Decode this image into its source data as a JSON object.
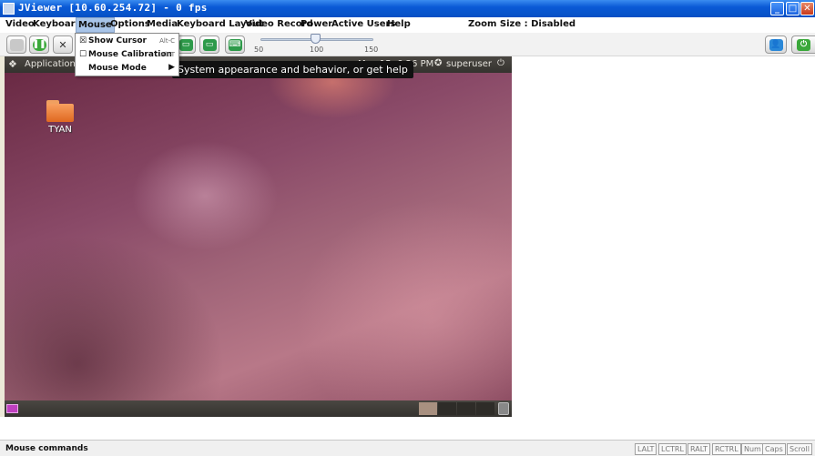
{
  "window": {
    "title": "JViewer [10.60.254.72] - 0 fps",
    "controls": {
      "minimize": "_",
      "maximize": "□",
      "close": "✕"
    }
  },
  "menubar": {
    "items": [
      "Video",
      "Keyboard",
      "Mouse",
      "Options",
      "Media",
      "Keyboard Layout",
      "Video Record",
      "Power",
      "Active Users",
      "Help"
    ],
    "active": "Mouse",
    "zoom_label": "Zoom Size : Disabled"
  },
  "toolbar": {
    "slider": {
      "ticks": [
        "50",
        "100",
        "150"
      ],
      "value": 100
    }
  },
  "mouse_menu": {
    "items": [
      {
        "label": "Show Cursor",
        "accel": "Alt-C",
        "check": "☒"
      },
      {
        "label": "Mouse Calibration",
        "accel": "Alt-T",
        "check": "☐"
      },
      {
        "label": "Mouse Mode",
        "submenu_arrow": "▶"
      }
    ]
  },
  "remote_desktop": {
    "top_panel": {
      "applications": "Applications",
      "datetime": "May 15,  6:26 PM",
      "user": "superuser",
      "power_glyph": "⏻"
    },
    "tooltip": "System appearance and behavior, or get help",
    "desktop_icon_label": "TYAN"
  },
  "statusbar": {
    "text": "Mouse commands",
    "key_indicators": [
      "LALT",
      "LCTRL",
      "RALT",
      "RCTRL",
      "Num",
      "Caps",
      "Scroll"
    ]
  },
  "colors": {
    "titlebar": "#0a5ad6",
    "menu_highlight": "#a8c4e8"
  }
}
